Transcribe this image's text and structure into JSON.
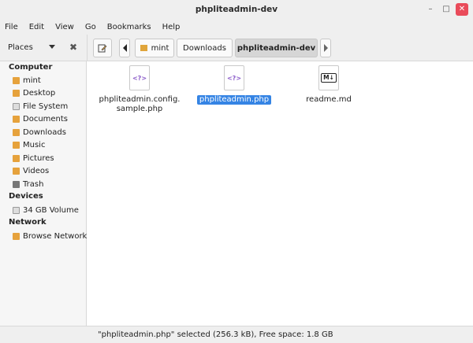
{
  "window": {
    "title": "phpliteadmin-dev",
    "minimize": "–",
    "maximize": "□",
    "close": "✕"
  },
  "menu": [
    "File",
    "Edit",
    "View",
    "Go",
    "Bookmarks",
    "Help"
  ],
  "sidebar_header": {
    "label": "Places",
    "close": "✖"
  },
  "toolbar": {
    "crumbs": [
      "mint",
      "Downloads",
      "phpliteadmin-dev"
    ]
  },
  "sidebar": {
    "computer_heading": "Computer",
    "computer_items": [
      "mint",
      "Desktop",
      "File System",
      "Documents",
      "Downloads",
      "Music",
      "Pictures",
      "Videos",
      "Trash"
    ],
    "devices_heading": "Devices",
    "devices_items": [
      "34 GB Volume"
    ],
    "network_heading": "Network",
    "network_items": [
      "Browse Network"
    ]
  },
  "files": [
    {
      "name_line1": "phpliteadmin.config.",
      "name_line2": "sample.php",
      "icon": "php-file-icon",
      "glyph": "<?>"
    },
    {
      "name_line1": "phpliteadmin.php",
      "icon": "php-file-icon",
      "glyph": "<?>",
      "selected": true
    },
    {
      "name_line1": "readme.md",
      "icon": "markdown-file-icon",
      "glyph": "M↓"
    }
  ],
  "status": "\"phpliteadmin.php\" selected (256.3 kB), Free space: 1.8 GB",
  "colors": {
    "selection": "#3584e4",
    "folder": "#e6a23c",
    "close": "#e94b5a"
  }
}
